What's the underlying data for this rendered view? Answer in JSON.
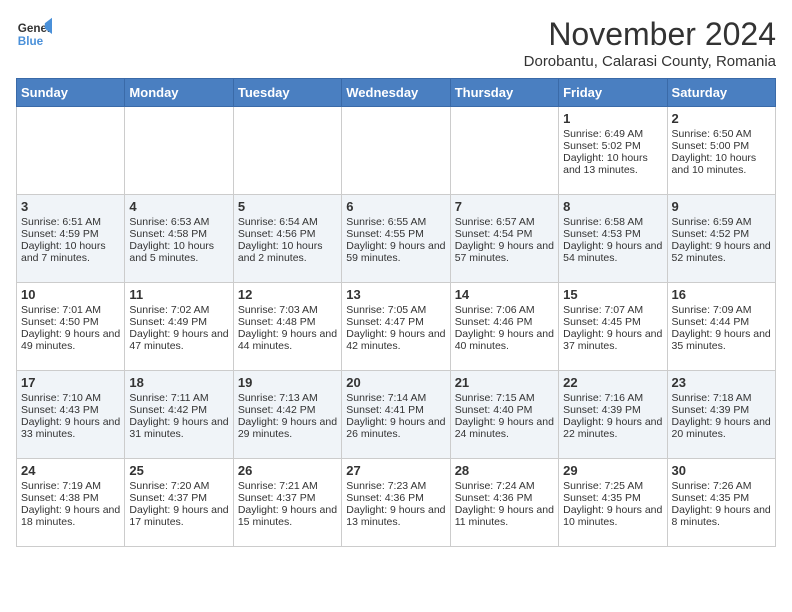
{
  "logo": {
    "line1": "General",
    "line2": "Blue"
  },
  "title": "November 2024",
  "location": "Dorobantu, Calarasi County, Romania",
  "days_of_week": [
    "Sunday",
    "Monday",
    "Tuesday",
    "Wednesday",
    "Thursday",
    "Friday",
    "Saturday"
  ],
  "weeks": [
    [
      {
        "day": "",
        "info": ""
      },
      {
        "day": "",
        "info": ""
      },
      {
        "day": "",
        "info": ""
      },
      {
        "day": "",
        "info": ""
      },
      {
        "day": "",
        "info": ""
      },
      {
        "day": "1",
        "info": "Sunrise: 6:49 AM\nSunset: 5:02 PM\nDaylight: 10 hours and 13 minutes."
      },
      {
        "day": "2",
        "info": "Sunrise: 6:50 AM\nSunset: 5:00 PM\nDaylight: 10 hours and 10 minutes."
      }
    ],
    [
      {
        "day": "3",
        "info": "Sunrise: 6:51 AM\nSunset: 4:59 PM\nDaylight: 10 hours and 7 minutes."
      },
      {
        "day": "4",
        "info": "Sunrise: 6:53 AM\nSunset: 4:58 PM\nDaylight: 10 hours and 5 minutes."
      },
      {
        "day": "5",
        "info": "Sunrise: 6:54 AM\nSunset: 4:56 PM\nDaylight: 10 hours and 2 minutes."
      },
      {
        "day": "6",
        "info": "Sunrise: 6:55 AM\nSunset: 4:55 PM\nDaylight: 9 hours and 59 minutes."
      },
      {
        "day": "7",
        "info": "Sunrise: 6:57 AM\nSunset: 4:54 PM\nDaylight: 9 hours and 57 minutes."
      },
      {
        "day": "8",
        "info": "Sunrise: 6:58 AM\nSunset: 4:53 PM\nDaylight: 9 hours and 54 minutes."
      },
      {
        "day": "9",
        "info": "Sunrise: 6:59 AM\nSunset: 4:52 PM\nDaylight: 9 hours and 52 minutes."
      }
    ],
    [
      {
        "day": "10",
        "info": "Sunrise: 7:01 AM\nSunset: 4:50 PM\nDaylight: 9 hours and 49 minutes."
      },
      {
        "day": "11",
        "info": "Sunrise: 7:02 AM\nSunset: 4:49 PM\nDaylight: 9 hours and 47 minutes."
      },
      {
        "day": "12",
        "info": "Sunrise: 7:03 AM\nSunset: 4:48 PM\nDaylight: 9 hours and 44 minutes."
      },
      {
        "day": "13",
        "info": "Sunrise: 7:05 AM\nSunset: 4:47 PM\nDaylight: 9 hours and 42 minutes."
      },
      {
        "day": "14",
        "info": "Sunrise: 7:06 AM\nSunset: 4:46 PM\nDaylight: 9 hours and 40 minutes."
      },
      {
        "day": "15",
        "info": "Sunrise: 7:07 AM\nSunset: 4:45 PM\nDaylight: 9 hours and 37 minutes."
      },
      {
        "day": "16",
        "info": "Sunrise: 7:09 AM\nSunset: 4:44 PM\nDaylight: 9 hours and 35 minutes."
      }
    ],
    [
      {
        "day": "17",
        "info": "Sunrise: 7:10 AM\nSunset: 4:43 PM\nDaylight: 9 hours and 33 minutes."
      },
      {
        "day": "18",
        "info": "Sunrise: 7:11 AM\nSunset: 4:42 PM\nDaylight: 9 hours and 31 minutes."
      },
      {
        "day": "19",
        "info": "Sunrise: 7:13 AM\nSunset: 4:42 PM\nDaylight: 9 hours and 29 minutes."
      },
      {
        "day": "20",
        "info": "Sunrise: 7:14 AM\nSunset: 4:41 PM\nDaylight: 9 hours and 26 minutes."
      },
      {
        "day": "21",
        "info": "Sunrise: 7:15 AM\nSunset: 4:40 PM\nDaylight: 9 hours and 24 minutes."
      },
      {
        "day": "22",
        "info": "Sunrise: 7:16 AM\nSunset: 4:39 PM\nDaylight: 9 hours and 22 minutes."
      },
      {
        "day": "23",
        "info": "Sunrise: 7:18 AM\nSunset: 4:39 PM\nDaylight: 9 hours and 20 minutes."
      }
    ],
    [
      {
        "day": "24",
        "info": "Sunrise: 7:19 AM\nSunset: 4:38 PM\nDaylight: 9 hours and 18 minutes."
      },
      {
        "day": "25",
        "info": "Sunrise: 7:20 AM\nSunset: 4:37 PM\nDaylight: 9 hours and 17 minutes."
      },
      {
        "day": "26",
        "info": "Sunrise: 7:21 AM\nSunset: 4:37 PM\nDaylight: 9 hours and 15 minutes."
      },
      {
        "day": "27",
        "info": "Sunrise: 7:23 AM\nSunset: 4:36 PM\nDaylight: 9 hours and 13 minutes."
      },
      {
        "day": "28",
        "info": "Sunrise: 7:24 AM\nSunset: 4:36 PM\nDaylight: 9 hours and 11 minutes."
      },
      {
        "day": "29",
        "info": "Sunrise: 7:25 AM\nSunset: 4:35 PM\nDaylight: 9 hours and 10 minutes."
      },
      {
        "day": "30",
        "info": "Sunrise: 7:26 AM\nSunset: 4:35 PM\nDaylight: 9 hours and 8 minutes."
      }
    ]
  ]
}
